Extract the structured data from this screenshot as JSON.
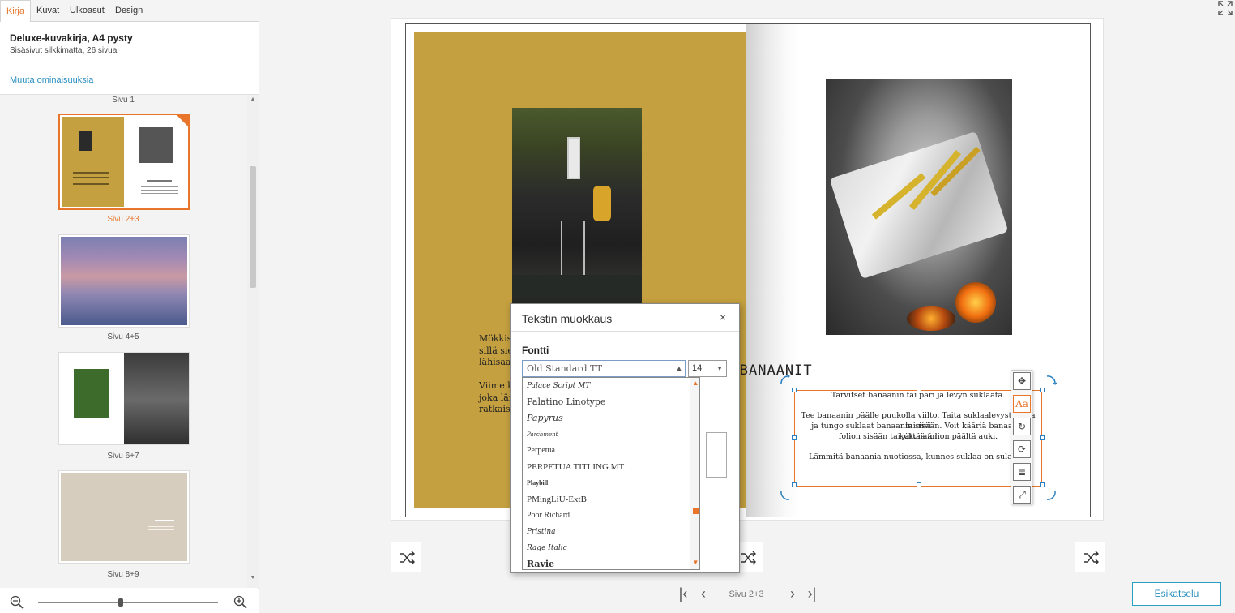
{
  "tabs": [
    "Kirja",
    "Kuvat",
    "Ulkoasut",
    "Design"
  ],
  "active_tab": "Kirja",
  "book": {
    "title": "Deluxe-kuvakirja, A4 pysty",
    "subtitle": "Sisäsivut silkkimatta, 26 sivua",
    "change_link": "Muuta ominaisuuksia"
  },
  "pages": {
    "first_label": "Sivu 1",
    "thumbs": [
      {
        "label": "Sivu 2+3",
        "active": true
      },
      {
        "label": "Sivu 4+5",
        "active": false
      },
      {
        "label": "Sivu 6+7",
        "active": false
      },
      {
        "label": "Sivu 8+9",
        "active": false
      }
    ]
  },
  "spread": {
    "heading": "NUOTIOBANAANIT",
    "left_text_lines": [
      "Mökkissä",
      "sillä siel",
      "lähisaar",
      "",
      "Viime k",
      "joka läm",
      "ratkaisu"
    ],
    "right_text_lines": [
      "Tarvitset banaanin tai pari ja levyn suklaata.",
      "",
      "Tee banaanin päälle puukolla viilto. Taita suklaalevystä pala tai rivi",
      "ja tungo suklaat banaanin sisään. Voit kääriä banaanin kokonaan",
      "folion sisään tai jättää folion päältä auki.",
      "",
      "Lämmitä banaania nuotiossa, kunnes suklaa on sulanut."
    ]
  },
  "dialog": {
    "title": "Tekstin muokkaus",
    "close": "×",
    "font_label": "Fontti",
    "font_value": "Old Standard TT",
    "size_value": "14",
    "font_options": [
      "Palace Script MT",
      "Palatino Linotype",
      "Papyrus",
      "Parchment",
      "Perpetua",
      "PERPETUA TITLING MT",
      "Playbill",
      "PMingLiU-ExtB",
      "Poor Richard",
      "Pristina",
      "Rage Italic",
      "Ravie"
    ]
  },
  "navigation": {
    "label": "Sivu 2+3",
    "preview_button": "Esikatselu"
  },
  "colors": {
    "accent": "#e8752a",
    "link": "#2a8fbf",
    "gold_page": "#c5a040"
  },
  "icons": {
    "zoom_out": "zoom-out-icon",
    "zoom_in": "zoom-in-icon",
    "shuffle": "shuffle-icon",
    "fullscreen": "fullscreen-icon"
  }
}
